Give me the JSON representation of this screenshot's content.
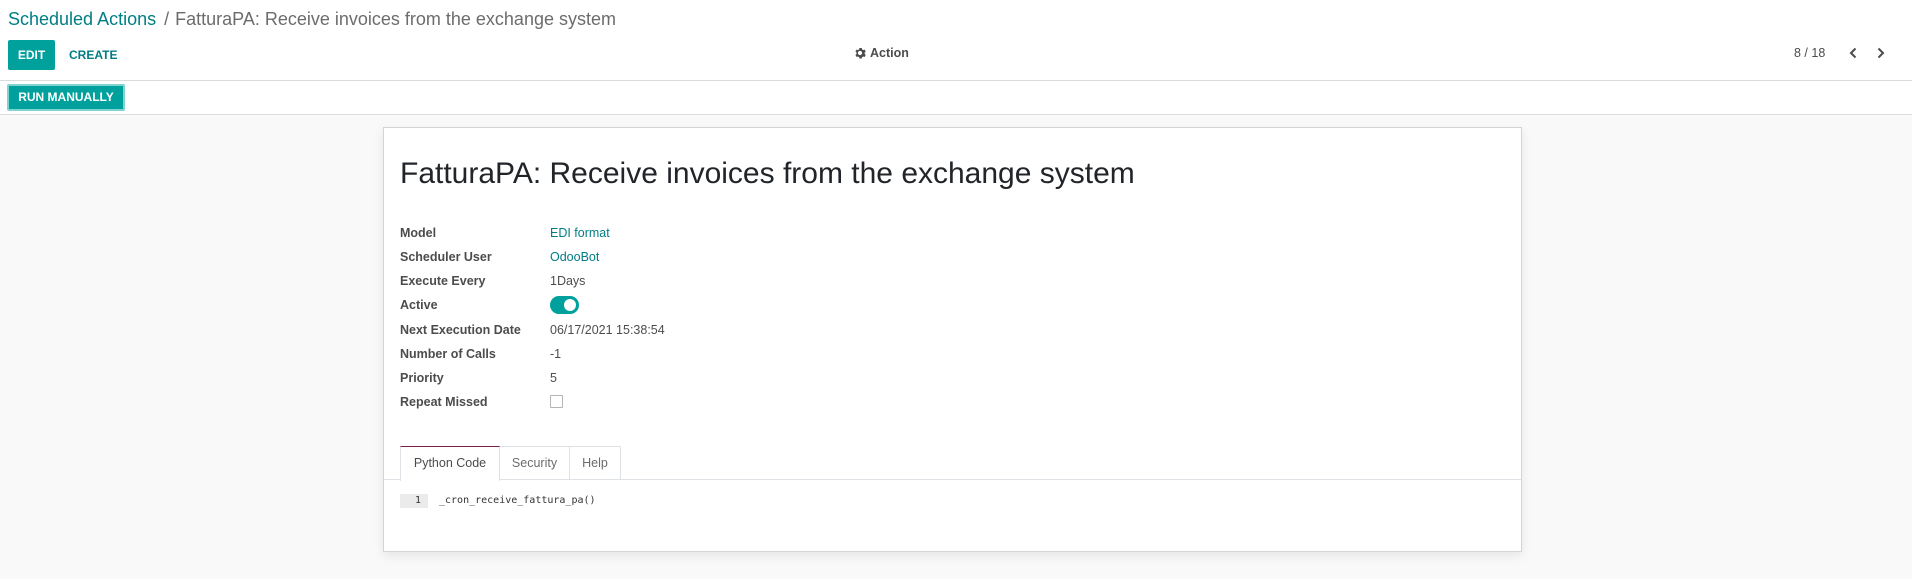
{
  "breadcrumb": {
    "parent": "Scheduled Actions",
    "separator": "/",
    "current": "FatturaPA: Receive invoices from the exchange system"
  },
  "toolbar": {
    "edit_label": "EDIT",
    "create_label": "CREATE",
    "action_label": "Action",
    "action_icon": "gear-icon",
    "pager_text": "8 / 18",
    "prev_icon": "chevron-left-icon",
    "next_icon": "chevron-right-icon"
  },
  "statusbar": {
    "run_label": "RUN MANUALLY"
  },
  "record": {
    "title": "FatturaPA: Receive invoices from the exchange system",
    "fields": {
      "model": {
        "label": "Model",
        "value": "EDI format"
      },
      "scheduler_user": {
        "label": "Scheduler User",
        "value": "OdooBot"
      },
      "execute_every": {
        "label": "Execute Every",
        "value": "1Days"
      },
      "active": {
        "label": "Active",
        "checked": true
      },
      "next_execution_date": {
        "label": "Next Execution Date",
        "value": "06/17/2021 15:38:54"
      },
      "number_of_calls": {
        "label": "Number of Calls",
        "value": "-1"
      },
      "priority": {
        "label": "Priority",
        "value": "5"
      },
      "repeat_missed": {
        "label": "Repeat Missed",
        "checked": false
      }
    }
  },
  "tabs": [
    {
      "label": "Python Code",
      "active": true
    },
    {
      "label": "Security",
      "active": false
    },
    {
      "label": "Help",
      "active": false
    }
  ],
  "code": {
    "line_number": "1",
    "line": "_cron_receive_fattura_pa()"
  },
  "colors": {
    "primary": "#00a09d",
    "link": "#017e84",
    "tab_accent": "#7c1d4c"
  }
}
